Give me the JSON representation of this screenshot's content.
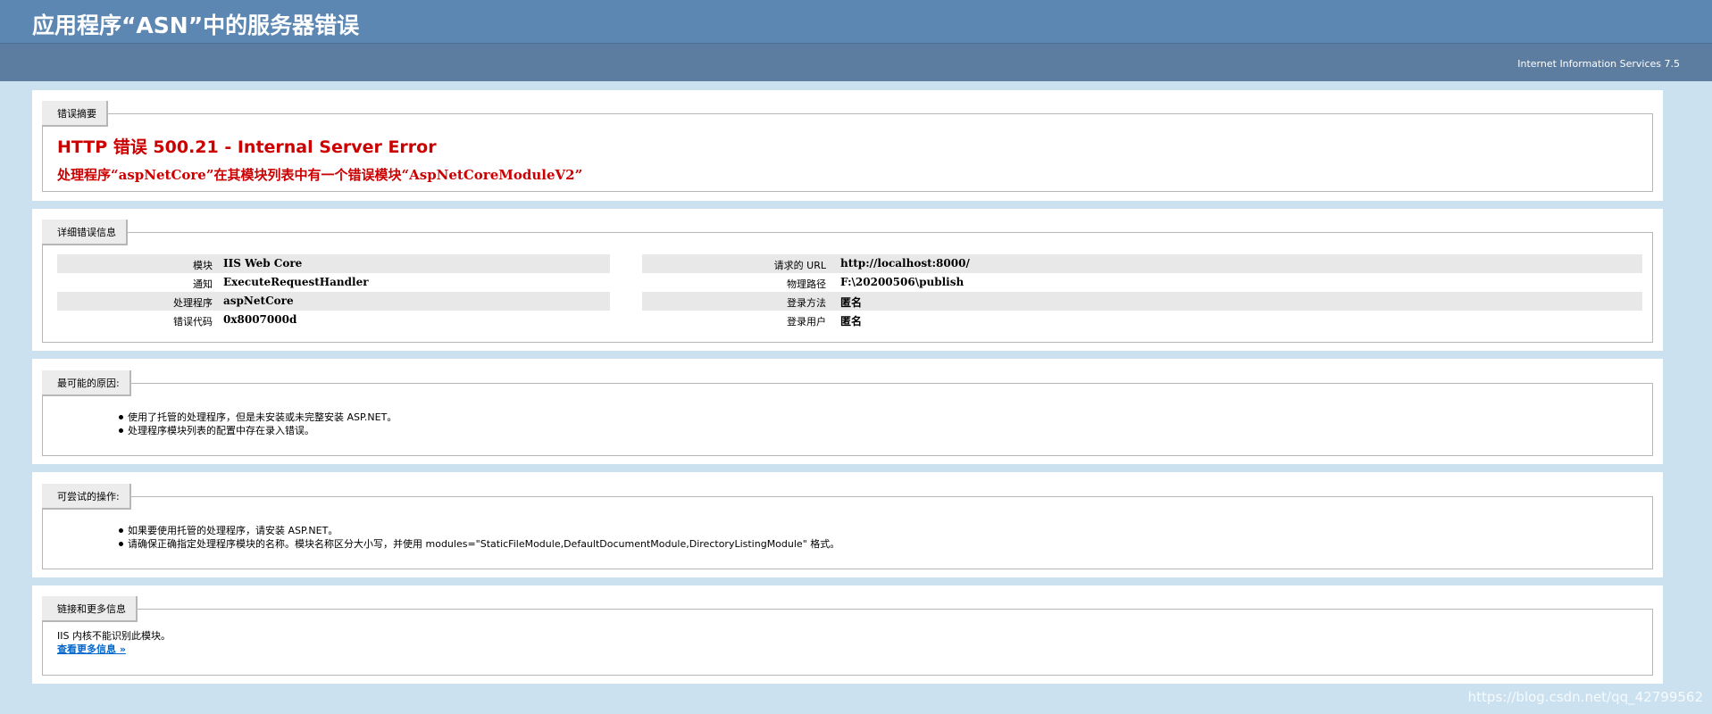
{
  "header": {
    "title": "应用程序“ASN”中的服务器错误",
    "server_info": "Internet Information Services 7.5"
  },
  "summary": {
    "legend": "错误摘要",
    "heading": "HTTP 错误 500.21 - Internal Server Error",
    "subheading": "处理程序“aspNetCore”在其模块列表中有一个错误模块“AspNetCoreModuleV2”"
  },
  "details": {
    "legend": "详细错误信息",
    "left": [
      {
        "key": "模块",
        "value": "IIS Web Core"
      },
      {
        "key": "通知",
        "value": "ExecuteRequestHandler"
      },
      {
        "key": "处理程序",
        "value": "aspNetCore"
      },
      {
        "key": "错误代码",
        "value": "0x8007000d"
      }
    ],
    "right": [
      {
        "key": "请求的 URL",
        "value": "http://localhost:8000/"
      },
      {
        "key": "物理路径",
        "value": "F:\\20200506\\publish"
      },
      {
        "key": "登录方法",
        "value": "匿名"
      },
      {
        "key": "登录用户",
        "value": "匿名"
      }
    ]
  },
  "causes": {
    "legend": "最可能的原因:",
    "items": [
      "使用了托管的处理程序，但是未安装或未完整安装 ASP.NET。",
      "处理程序模块列表的配置中存在录入错误。"
    ]
  },
  "actions": {
    "legend": "可尝试的操作:",
    "items": [
      "如果要使用托管的处理程序，请安装 ASP.NET。",
      "请确保正确指定处理程序模块的名称。模块名称区分大小写，并使用 modules=\"StaticFileModule,DefaultDocumentModule,DirectoryListingModule\" 格式。"
    ]
  },
  "links": {
    "legend": "链接和更多信息",
    "text": "IIS 内核不能识别此模块。",
    "more_link": "查看更多信息 »"
  },
  "watermark": "https://blog.csdn.net/qq_42799562",
  "colors": {
    "header_bg": "#5c87b2",
    "server_bg": "#5c7ca0",
    "page_bg": "#cbe1ef",
    "error_red": "#cc0000",
    "link_blue": "#0066cc"
  }
}
